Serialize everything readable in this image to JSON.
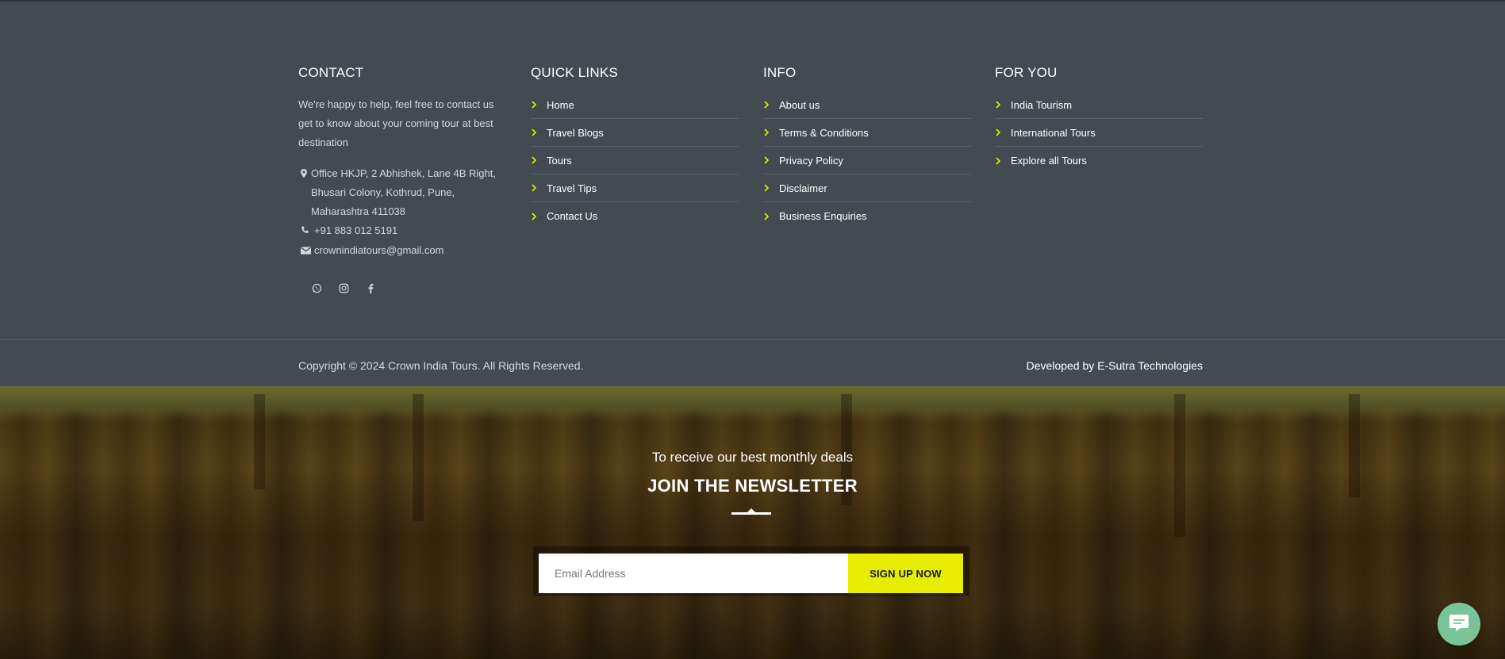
{
  "contact": {
    "heading": "CONTACT",
    "about": "We're happy to help, feel free to contact us get to know about your coming tour at best destination",
    "address": "Office HKJP, 2 Abhishek, Lane 4B Right, Bhusari Colony, Kothrud, Pune, Maharashtra 411038",
    "phone": "+91 883 012 5191",
    "email": "crownindiatours@gmail.com",
    "icons": {
      "address": "map-pin-icon",
      "phone": "phone-icon",
      "email": "envelope-icon"
    },
    "social": [
      "whatsapp-icon",
      "instagram-icon",
      "facebook-icon"
    ]
  },
  "quick_links": {
    "heading": "QUICK LINKS",
    "items": [
      {
        "label": "Home"
      },
      {
        "label": "Travel Blogs"
      },
      {
        "label": "Tours"
      },
      {
        "label": "Travel Tips"
      },
      {
        "label": "Contact Us"
      }
    ]
  },
  "info": {
    "heading": "INFO",
    "items": [
      {
        "label": "About us"
      },
      {
        "label": "Terms & Conditions"
      },
      {
        "label": "Privacy Policy"
      },
      {
        "label": "Disclaimer"
      },
      {
        "label": "Business Enquiries"
      }
    ]
  },
  "for_you": {
    "heading": "FOR YOU",
    "items": [
      {
        "label": "India Tourism"
      },
      {
        "label": "International Tours"
      },
      {
        "label": "Explore all Tours"
      }
    ]
  },
  "bottom": {
    "copyright": "Copyright © 2024 Crown India Tours. All Rights Reserved.",
    "developed_prefix": "Developed by",
    "developed_link": "E-Sutra Technologies"
  },
  "newsletter": {
    "subtitle": "To receive our best monthly deals",
    "title": "JOIN THE NEWSLETTER",
    "email_placeholder": "Email Address",
    "button_label": "SIGN UP NOW"
  },
  "colors": {
    "footer_bg": "#434a51",
    "accent_yellow": "#e8ed00",
    "chat_green": "#7bc49a"
  },
  "chat": {
    "icon": "chat-bubble-icon"
  }
}
